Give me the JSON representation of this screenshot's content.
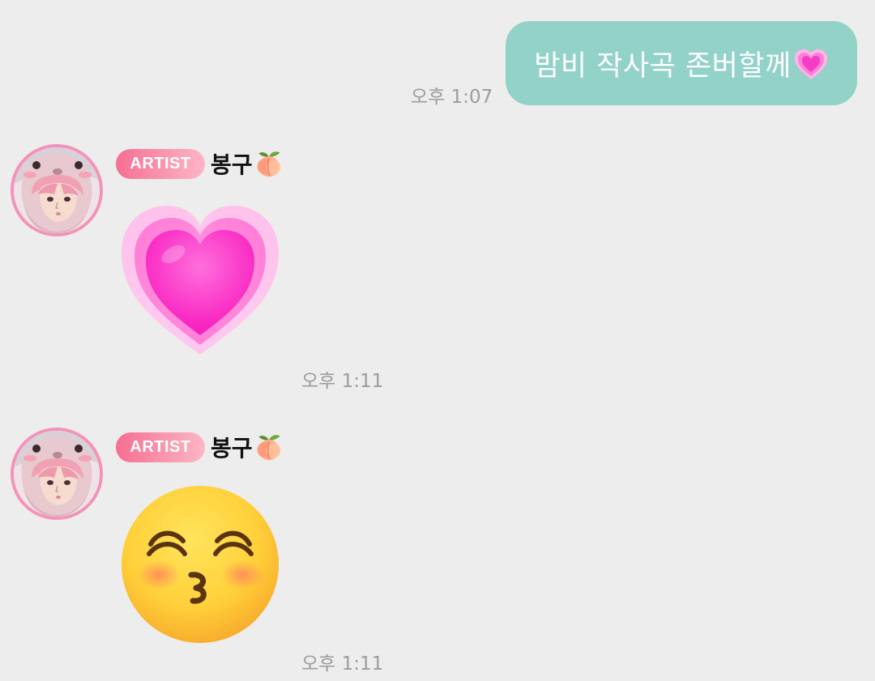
{
  "outgoing": {
    "text": "밤비 작사곡 존버할께",
    "emoji": "growing-heart-emoji",
    "time": "오후 1:07",
    "bubble_color": "#92d2c9"
  },
  "messages": [
    {
      "badge": "ARTIST",
      "sender": "봉구",
      "sender_emoji": "peach-emoji",
      "sticker": "pink-heart-emoji",
      "time": "오후 1:11"
    },
    {
      "badge": "ARTIST",
      "sender": "봉구",
      "sender_emoji": "peach-emoji",
      "sticker": "kissing-face-emoji",
      "time": "오후 1:11"
    }
  ],
  "colors": {
    "background": "#ededed",
    "badge_start": "#f66f92",
    "badge_end": "#fdb6c7",
    "avatar_ring": "#f492b9",
    "timestamp": "#9c9c9c"
  }
}
